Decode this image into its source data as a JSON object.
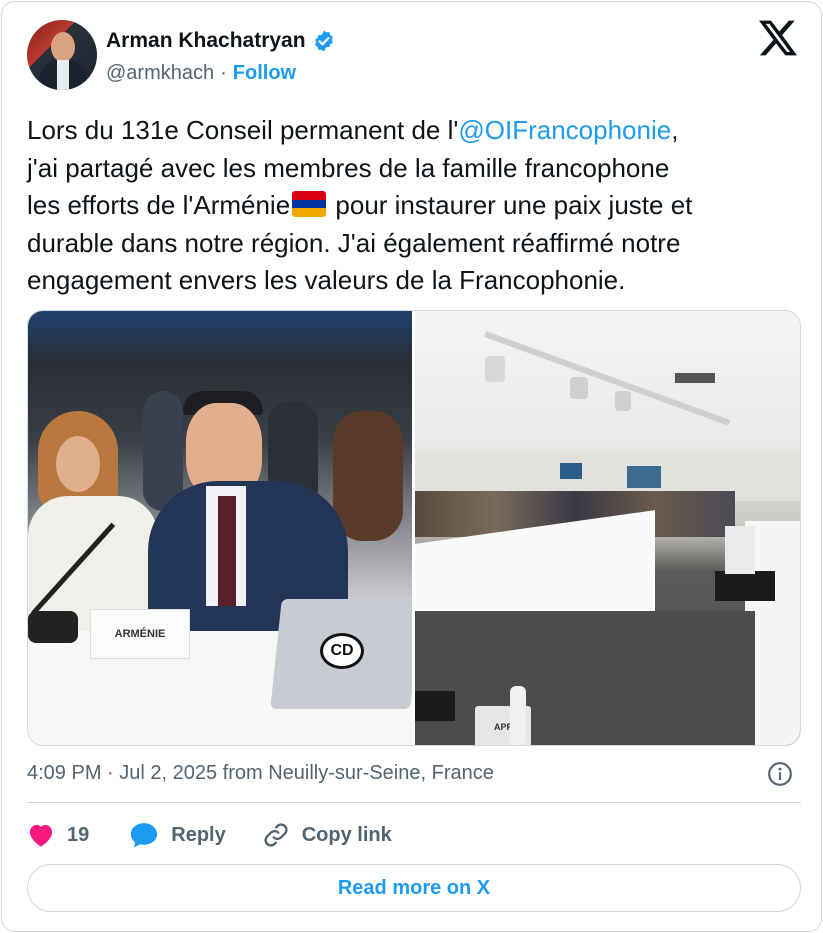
{
  "author": {
    "display_name": "Arman Khachatryan",
    "handle": "@armkhach",
    "separator": "·",
    "follow_label": "Follow"
  },
  "tweet": {
    "text_part1": "Lors du 131e Conseil permanent de l'",
    "mention": "@OIFrancophonie",
    "text_part2": ",\nj'ai partagé avec les membres de la famille francophone\nles efforts de l'Arménie",
    "text_part3": " pour instaurer une paix juste et\ndurable dans notre région. J'ai également réaffirmé notre\nengagement envers les valeurs de la Francophonie.",
    "flag_icon": "armenia-flag-icon",
    "flag_colors": [
      "#d90012",
      "#0033a0",
      "#f2a800"
    ]
  },
  "media": {
    "photo_left_nameplate": "ARMÉNIE",
    "photo_left_laptop_sticker": "CD",
    "photo_right_sign": "APF"
  },
  "meta": {
    "timestamp": "4:09 PM · Jul 2, 2025 from Neuilly-sur-Seine, France"
  },
  "actions": {
    "like_count": "19",
    "reply_label": "Reply",
    "copy_link_label": "Copy link"
  },
  "read_more_label": "Read more on X",
  "colors": {
    "accent": "#1d9bf0",
    "like": "#f91880",
    "text": "#0f1419",
    "muted": "#536471",
    "border": "#cfd9de"
  }
}
